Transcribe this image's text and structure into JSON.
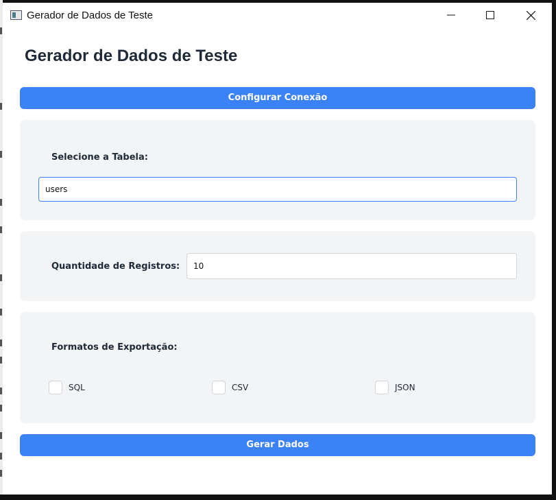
{
  "window": {
    "title": "Gerador de Dados de Teste",
    "icons": {
      "app": "app-window-icon",
      "minimize": "minimize-icon",
      "maximize": "maximize-icon",
      "close": "close-icon"
    }
  },
  "page": {
    "heading": "Gerador de Dados de Teste"
  },
  "config_button": {
    "label": "Configurar Conexão"
  },
  "table_section": {
    "label": "Selecione a Tabela:",
    "value": "users"
  },
  "quantity_section": {
    "label": "Quantidade de Registros:",
    "value": "10"
  },
  "formats_section": {
    "label": "Formatos de Exportação:",
    "options": [
      {
        "label": "SQL",
        "checked": false
      },
      {
        "label": "CSV",
        "checked": false
      },
      {
        "label": "JSON",
        "checked": false
      }
    ]
  },
  "generate_button": {
    "label": "Gerar Dados"
  },
  "colors": {
    "accent": "#3b82f6",
    "card_bg": "#f3f4f6",
    "text": "#1f2937"
  }
}
